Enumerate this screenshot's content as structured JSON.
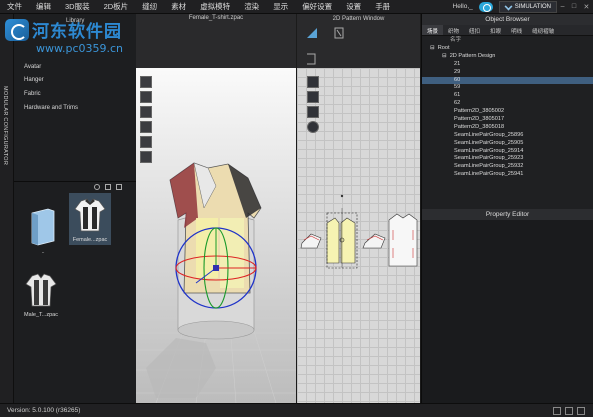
{
  "menu": {
    "items": [
      "文件",
      "编辑",
      "3D服装",
      "2D板片",
      "缝纫",
      "素材",
      "虚拟模特",
      "渲染",
      "显示",
      "偏好设置",
      "设置",
      "手册"
    ],
    "hello": "Hello,_",
    "simulation": "SIMULATION"
  },
  "watermark": {
    "text": "河东软件园",
    "url": "www.pc0359.cn"
  },
  "sidebar": {
    "vertical_label": "MODULAR CONFIGURATOR"
  },
  "library": {
    "tab": "Library",
    "categories": [
      "Avatar",
      "Hanger",
      "Fabric",
      "Hardware and Trims"
    ],
    "files": [
      {
        "caption": ".."
      },
      {
        "caption": "Female...zpac"
      },
      {
        "caption": "Male_T...zpac"
      }
    ]
  },
  "window3d": {
    "title": "Female_T-shirt.zpac"
  },
  "window2d": {
    "title": "2D Pattern Window"
  },
  "object_browser": {
    "title": "Object Browser",
    "tabs": [
      "场景",
      "织物",
      "纽扣",
      "扣眼",
      "明线",
      "缝纫褶皱"
    ],
    "column_header": "名字",
    "tree": [
      {
        "label": "Root",
        "indent": 0,
        "toggle": "⊟"
      },
      {
        "label": "2D Pattern Design",
        "indent": 1,
        "toggle": "⊟"
      },
      {
        "label": "21",
        "indent": 2,
        "toggle": ""
      },
      {
        "label": "29",
        "indent": 2,
        "toggle": ""
      },
      {
        "label": "60",
        "indent": 2,
        "toggle": "",
        "selected": true
      },
      {
        "label": "59",
        "indent": 2,
        "toggle": ""
      },
      {
        "label": "61",
        "indent": 2,
        "toggle": ""
      },
      {
        "label": "62",
        "indent": 2,
        "toggle": ""
      },
      {
        "label": "Pattern2D_3805002",
        "indent": 2,
        "toggle": ""
      },
      {
        "label": "Pattern2D_3805017",
        "indent": 2,
        "toggle": ""
      },
      {
        "label": "Pattern2D_3805018",
        "indent": 2,
        "toggle": ""
      },
      {
        "label": "SeamLinePairGroup_25896",
        "indent": 2,
        "toggle": ""
      },
      {
        "label": "SeamLinePairGroup_25905",
        "indent": 2,
        "toggle": ""
      },
      {
        "label": "SeamLinePairGroup_25914",
        "indent": 2,
        "toggle": ""
      },
      {
        "label": "SeamLinePairGroup_25923",
        "indent": 2,
        "toggle": ""
      },
      {
        "label": "SeamLinePairGroup_25932",
        "indent": 2,
        "toggle": ""
      },
      {
        "label": "SeamLinePairGroup_25941",
        "indent": 2,
        "toggle": ""
      }
    ]
  },
  "property_editor": {
    "title": "Property Editor"
  },
  "status": {
    "version": "Version: 5.0.100 (r36265)"
  }
}
